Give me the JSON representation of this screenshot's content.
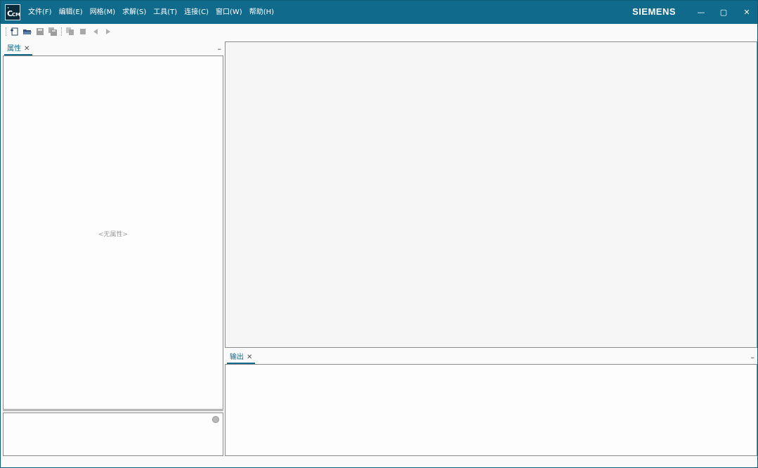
{
  "window": {
    "logo_main": "C",
    "logo_sub": "CM",
    "brand": "SIEMENS",
    "minimize_glyph": "—",
    "maximize_glyph": "▢",
    "close_glyph": "✕"
  },
  "menu": [
    {
      "label": "文件(F)"
    },
    {
      "label": "编辑(E)"
    },
    {
      "label": "网格(M)"
    },
    {
      "label": "求解(S)"
    },
    {
      "label": "工具(T)"
    },
    {
      "label": "连接(C)"
    },
    {
      "label": "窗口(W)"
    },
    {
      "label": "帮助(H)"
    }
  ],
  "toolbar": {
    "icons": [
      "new-file-icon",
      "open-folder-icon",
      "save-icon",
      "save-all-icon",
      "copy-icon",
      "stop-icon",
      "back-icon",
      "forward-icon"
    ]
  },
  "properties_panel": {
    "tab_label": "属性",
    "close_glyph": "✕",
    "minimize_glyph": "–",
    "empty_text": "<无属性>"
  },
  "output_panel": {
    "tab_label": "输出",
    "close_glyph": "✕",
    "minimize_glyph": "–"
  },
  "colors": {
    "titlebar": "#0f6a8c",
    "accent": "#0f6a8c"
  }
}
